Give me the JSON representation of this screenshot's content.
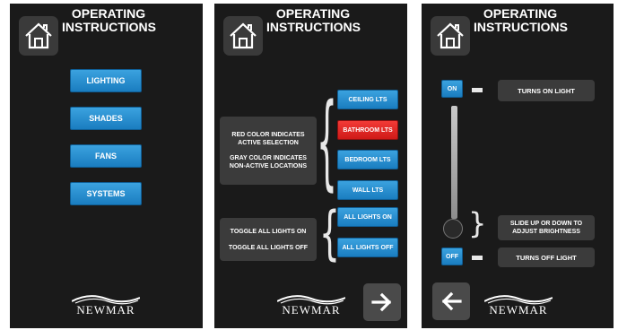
{
  "title_line1": "OPERATING",
  "title_line2": "INSTRUCTIONS",
  "logo_text": "NEWMAR",
  "menu": [
    "LIGHTING",
    "SHADES",
    "FANS",
    "SYSTEMS"
  ],
  "panel2": {
    "info_selection": [
      "RED COLOR INDICATES",
      "ACTIVE SELECTION"
    ],
    "info_gray": [
      "GRAY COLOR INDICATES",
      "NON-ACTIVE LOCATIONS"
    ],
    "locations": [
      "CEILING LTS",
      "BATHROOM LTS",
      "BEDROOM LTS",
      "WALL LTS"
    ],
    "toggle_info": [
      "TOGGLE ALL LIGHTS ON",
      "TOGGLE ALL LIGHTS OFF"
    ],
    "toggle_buttons": [
      "ALL LIGHTS ON",
      "ALL LIGHTS OFF"
    ]
  },
  "panel3": {
    "on_label": "ON",
    "off_label": "OFF",
    "turns_on": "TURNS ON LIGHT",
    "slide": [
      "SLIDE UP OR DOWN TO",
      "ADJUST BRIGHTNESS"
    ],
    "turns_off": "TURNS OFF LIGHT"
  },
  "colors": {
    "active": "#e0201e",
    "inactive": "#2a8fd2",
    "panel": "#1a1a1a",
    "info": "#3b3b3b"
  },
  "icons": [
    "home-icon",
    "arrow-right-icon",
    "arrow-left-icon"
  ]
}
